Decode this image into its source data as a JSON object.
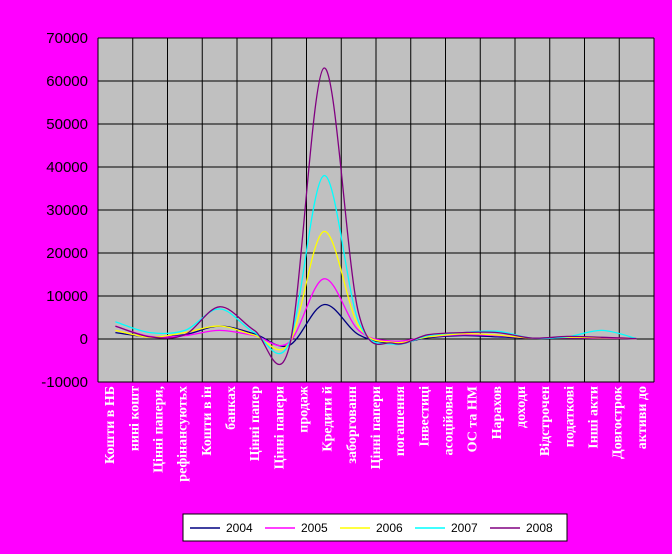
{
  "chart_data": {
    "type": "line",
    "title": "",
    "xlabel": "",
    "ylabel": "",
    "ylim": [
      -10000,
      70000
    ],
    "yticks": [
      -10000,
      0,
      10000,
      20000,
      30000,
      40000,
      50000,
      60000,
      70000
    ],
    "ytick_labels": [
      "-10000",
      "0",
      "10000",
      "20000",
      "30000",
      "40000",
      "50000",
      "60000",
      "70000"
    ],
    "grid": true,
    "legend_position": "bottom",
    "categories": [
      "Кошти в НБУ",
      "Кошти в інших банках",
      "Цінні папери, рефінансуються",
      "Кошти в інших банках",
      "Цінні папери",
      "Цінні папери",
      "Кредити й заборгованість",
      "Цінні папери",
      "Інвестиції",
      "Асоційовані",
      "ОС та НМ",
      "Нарахов. доходи",
      "Відстрочені",
      "Податкові",
      "Інші акти",
      "Довгострок. активи до продажу"
    ],
    "tick_labels": [
      "Кошти в НБ",
      "нині кошт",
      "Цінні папери,",
      "рефінансуютьх",
      "Кошти в ін",
      "банках",
      "Цінні папер",
      "Цінні папери",
      "продаж",
      "Кредити й",
      "заборгованн",
      "Цінні папери",
      "погашення",
      "Інвестиці",
      "асоційован",
      "ОС та НМ",
      "Нарахов",
      "доходи",
      "Відстрочен",
      "податкові",
      "Інші акти",
      "Довгострок",
      "активи до"
    ],
    "series": [
      {
        "name": "2004",
        "color": "#000080",
        "values": [
          1500,
          500,
          1000,
          3000,
          1200,
          -1500,
          8000,
          1000,
          -1000,
          300,
          800,
          500,
          200,
          300,
          200,
          100
        ]
      },
      {
        "name": "2005",
        "color": "#FF00FF",
        "values": [
          3000,
          600,
          800,
          2000,
          800,
          -800,
          14000,
          2000,
          -500,
          500,
          1000,
          800,
          200,
          300,
          200,
          100
        ]
      },
      {
        "name": "2006",
        "color": "#FFFF00",
        "values": [
          2000,
          400,
          1500,
          3000,
          900,
          -1000,
          25000,
          3000,
          -800,
          500,
          1200,
          900,
          200,
          400,
          300,
          100
        ]
      },
      {
        "name": "2007",
        "color": "#00FFFF",
        "values": [
          4000,
          1500,
          2000,
          7000,
          1500,
          -1000,
          38000,
          4000,
          -1200,
          800,
          1500,
          1800,
          200,
          500,
          2000,
          100
        ]
      },
      {
        "name": "2008",
        "color": "#800080",
        "values": [
          3000,
          500,
          1000,
          7500,
          2000,
          -2000,
          63000,
          6000,
          -1000,
          1000,
          1500,
          1500,
          200,
          600,
          400,
          100
        ]
      }
    ]
  }
}
